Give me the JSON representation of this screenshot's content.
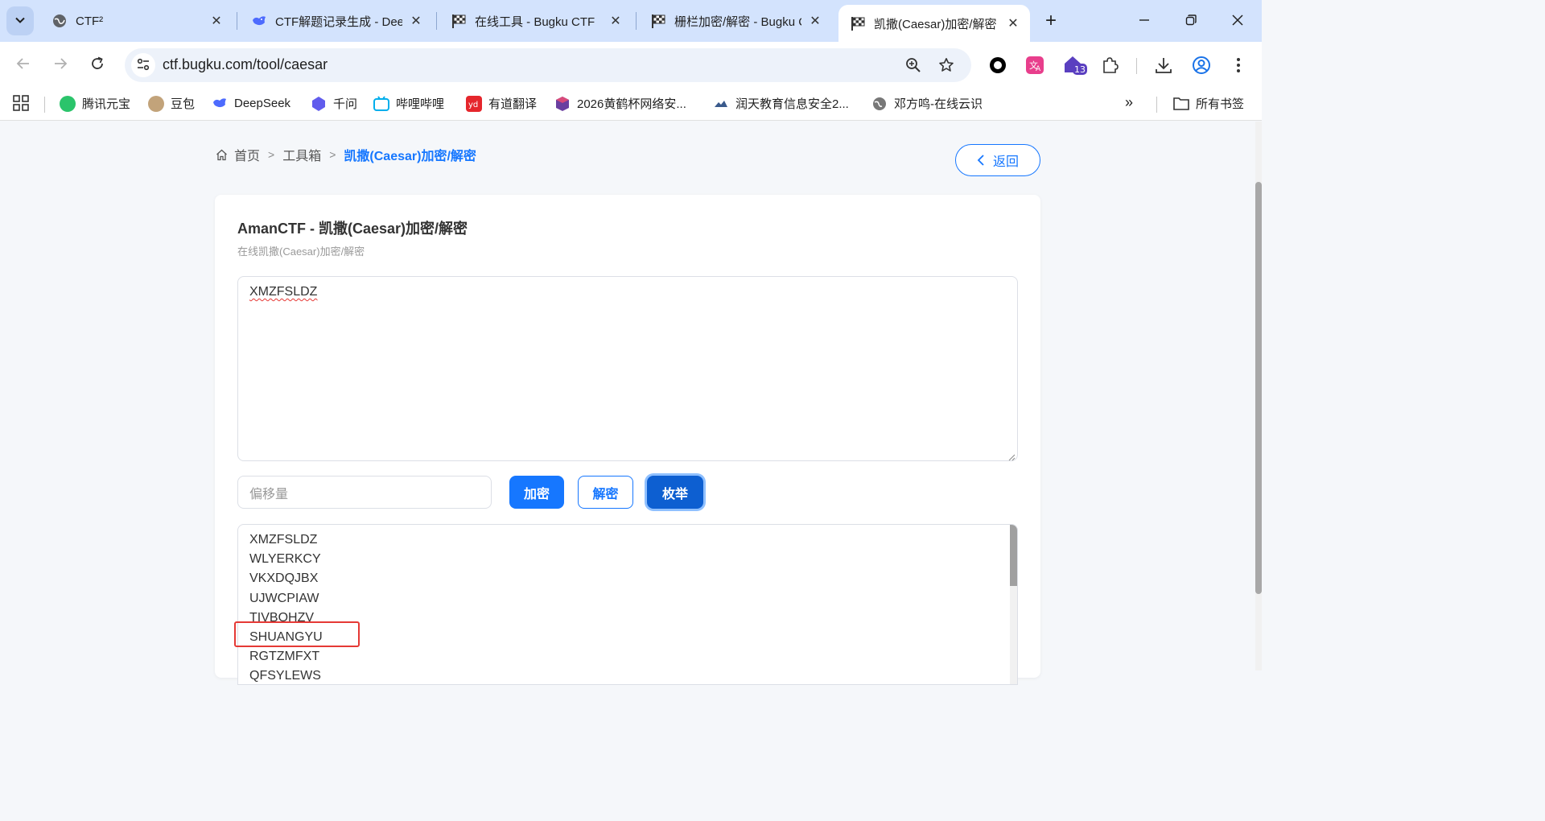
{
  "browser": {
    "tabs": [
      {
        "title": "CTF²",
        "favicon": "globe-icon"
      },
      {
        "title": "CTF解题记录生成 - DeepSeek",
        "favicon": "deepseek-icon"
      },
      {
        "title": "在线工具 - Bugku CTF",
        "favicon": "checkered-flag-icon"
      },
      {
        "title": "栅栏加密/解密 - Bugku CTF",
        "favicon": "checkered-flag-icon"
      },
      {
        "title": "凯撒(Caesar)加密/解密 - Bugku CTF",
        "favicon": "checkered-flag-icon"
      }
    ],
    "active_tab": 4,
    "url": "ctf.bugku.com/tool/caesar",
    "extension_badge": "13",
    "bookmarks": [
      {
        "label": "腾讯元宝",
        "color": "#2bc46b"
      },
      {
        "label": "豆包",
        "color": "#c2a37a"
      },
      {
        "label": "DeepSeek",
        "color": "#4d6bfe"
      },
      {
        "label": "千问",
        "color": "#615ced"
      },
      {
        "label": "哔哩哔哩",
        "color": "#00aeec"
      },
      {
        "label": "有道翻译",
        "color": "#e5262c"
      },
      {
        "label": "2026黄鹤杯网络安...",
        "color": "#6a3fa0"
      },
      {
        "label": "润天教育信息安全2...",
        "color": "#3a5a8c"
      },
      {
        "label": "邓方鸣-在线云识",
        "color": "#777777"
      }
    ],
    "all_bookmarks_label": "所有书签"
  },
  "page": {
    "breadcrumb": {
      "home": "首页",
      "toolbox": "工具箱",
      "current": "凯撒(Caesar)加密/解密"
    },
    "back_label": "返回",
    "card_title": "AmanCTF - 凯撒(Caesar)加密/解密",
    "card_subtitle": "在线凯撒(Caesar)加密/解密",
    "input_text": "XMZFSLDZ",
    "offset_placeholder": "偏移量",
    "buttons": {
      "encrypt": "加密",
      "decrypt": "解密",
      "enumerate": "枚举"
    },
    "output_lines": [
      "XMZFSLDZ",
      "WLYERKCY",
      "VKXDQJBX",
      "UJWCPIAW",
      "TIVBOHZV",
      "SHUANGYU",
      "RGTZMFXT",
      "QFSYLEWS"
    ],
    "colors": {
      "accent": "#1677ff",
      "highlight": "#e53935"
    }
  }
}
